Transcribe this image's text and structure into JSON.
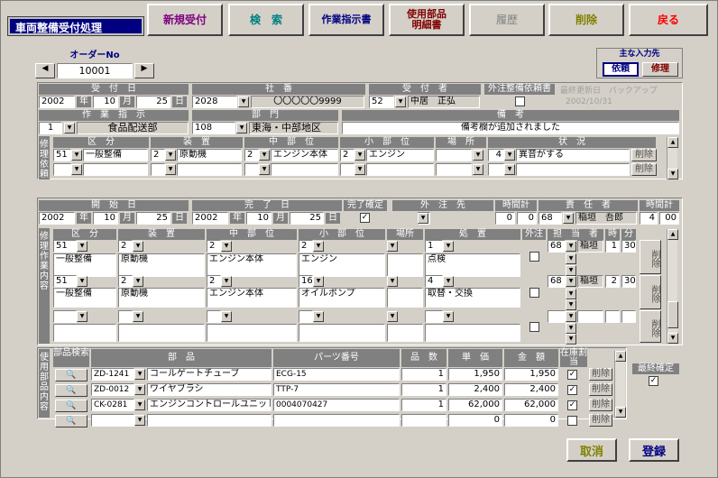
{
  "window_title": "車両整備受付処理",
  "toolbar": {
    "new": "新規受付",
    "search": "検　索",
    "work_order": "作業指示書",
    "parts_detail_1": "使用部品",
    "parts_detail_2": "明細書",
    "history": "履歴",
    "delete": "削除",
    "back": "戻る"
  },
  "order": {
    "label": "オーダーNo",
    "value": "10001",
    "prev": "◀",
    "next": "▶"
  },
  "main_input": {
    "label": "主な入力先",
    "request": "依頼",
    "repair": "修理"
  },
  "reception": {
    "date_label": "受　付　日",
    "year": "2002",
    "month": "10",
    "day": "25",
    "year_unit": "年",
    "month_unit": "月",
    "day_unit": "日",
    "company_label": "社　番",
    "company_code": "2028",
    "company_name": "〇〇〇〇〇9999",
    "receiver_label": "受　付　者",
    "receiver_code": "52",
    "receiver_name": "中居　正弘",
    "outsource_label": "外注整備依頼書",
    "last_update_label": "最終更新日",
    "last_update": "2002/10/31",
    "backup": "バックアップ"
  },
  "work_instruction": {
    "label": "作　業　指　示",
    "code": "1",
    "value": "食品配送部",
    "dept_label": "部　門",
    "dept_code": "108",
    "dept_value": "東海・中部地区",
    "note_label": "備　考",
    "note_value": "備考欄が追加されました"
  },
  "request_section": {
    "side_label": "修理依頼",
    "headers": [
      "区　分",
      "装　置",
      "中　部　位",
      "小　部　位",
      "場　所",
      "状　況"
    ],
    "rows": [
      {
        "kubun_code": "51",
        "kubun": "一般整備",
        "sochi_code": "2",
        "sochi": "原動機",
        "chu_code": "2",
        "chu": "エンジン本体",
        "sho_code": "2",
        "sho": "エンジン",
        "basho": "",
        "jokyo_code": "4",
        "jokyo": "異音がする"
      },
      {
        "kubun_code": "",
        "kubun": "",
        "sochi_code": "",
        "sochi": "",
        "chu_code": "",
        "chu": "",
        "sho_code": "",
        "sho": "",
        "basho": "",
        "jokyo_code": "",
        "jokyo": ""
      }
    ],
    "delete": "削除"
  },
  "work_period": {
    "start_label": "開　始　日",
    "start_year": "2002",
    "start_month": "10",
    "start_day": "25",
    "end_label": "完　了　日",
    "end_year": "2002",
    "end_month": "10",
    "end_day": "25",
    "complete_label": "完了確定",
    "outsource_label": "外　注　先",
    "hours_label": "時間計",
    "hours_h": "0",
    "hours_m": "0",
    "resp_label": "責　任　者",
    "resp_code": "68",
    "resp_name": "稲垣　吾郎",
    "total_label": "時間計",
    "total_h": "4",
    "total_m": "00"
  },
  "repair_section": {
    "side_label": "修理作業内容",
    "headers": [
      "区　分",
      "装　置",
      "中　部　位",
      "小　部　位",
      "場所",
      "処　置",
      "外注",
      "担　当　者",
      "時",
      "分"
    ],
    "rows": [
      {
        "kubun_code": "51",
        "kubun": "一般整備",
        "sochi_code": "2",
        "sochi": "原動機",
        "chu_code": "2",
        "chu": "エンジン本体",
        "sho_code": "2",
        "sho": "エンジン",
        "shochi_code": "1",
        "shochi": "点検",
        "tanto_code": "68",
        "tanto": "稲垣",
        "h": "1",
        "m": "30"
      },
      {
        "kubun_code": "51",
        "kubun": "一般整備",
        "sochi_code": "2",
        "sochi": "原動機",
        "chu_code": "2",
        "chu": "エンジン本体",
        "sho_code": "16",
        "sho": "オイルポンプ",
        "shochi_code": "4",
        "shochi": "取替・交換",
        "tanto_code": "68",
        "tanto": "稲垣",
        "h": "2",
        "m": "30"
      }
    ],
    "delete": "削除"
  },
  "parts_section": {
    "side_label": "使用部品内容",
    "headers": {
      "search": "部品検索",
      "part": "部　品",
      "number": "パーツ番号",
      "qty": "品　数",
      "unit": "単　価",
      "amount": "金　額",
      "stock": "在庫割当"
    },
    "rows": [
      {
        "code": "ZD-1241",
        "name": "コールゲートチューブ",
        "number": "ECG-15",
        "qty": "1",
        "unit": "1,950",
        "amount": "1,950",
        "stock": true
      },
      {
        "code": "ZD-0012",
        "name": "ワイヤブラシ",
        "number": "TTP-7",
        "qty": "1",
        "unit": "2,400",
        "amount": "2,400",
        "stock": true
      },
      {
        "code": "CK-0281",
        "name": "エンジンコントロールユニット",
        "number": "0004070427",
        "qty": "1",
        "unit": "62,000",
        "amount": "62,000",
        "stock": true
      },
      {
        "code": "",
        "name": "",
        "number": "",
        "qty": "",
        "unit": "0",
        "amount": "0",
        "stock": false
      }
    ],
    "delete": "削除",
    "final_label": "最終確定"
  },
  "footer": {
    "cancel": "取消",
    "register": "登録"
  },
  "colors": {
    "title_bg": "#000080",
    "new": "#800080",
    "search": "#008080",
    "work_order": "#000080",
    "parts": "#800000",
    "history": "#808080",
    "delete": "#808000",
    "back": "#ff0000",
    "label_bg": "#808080",
    "selected": "#000080"
  }
}
